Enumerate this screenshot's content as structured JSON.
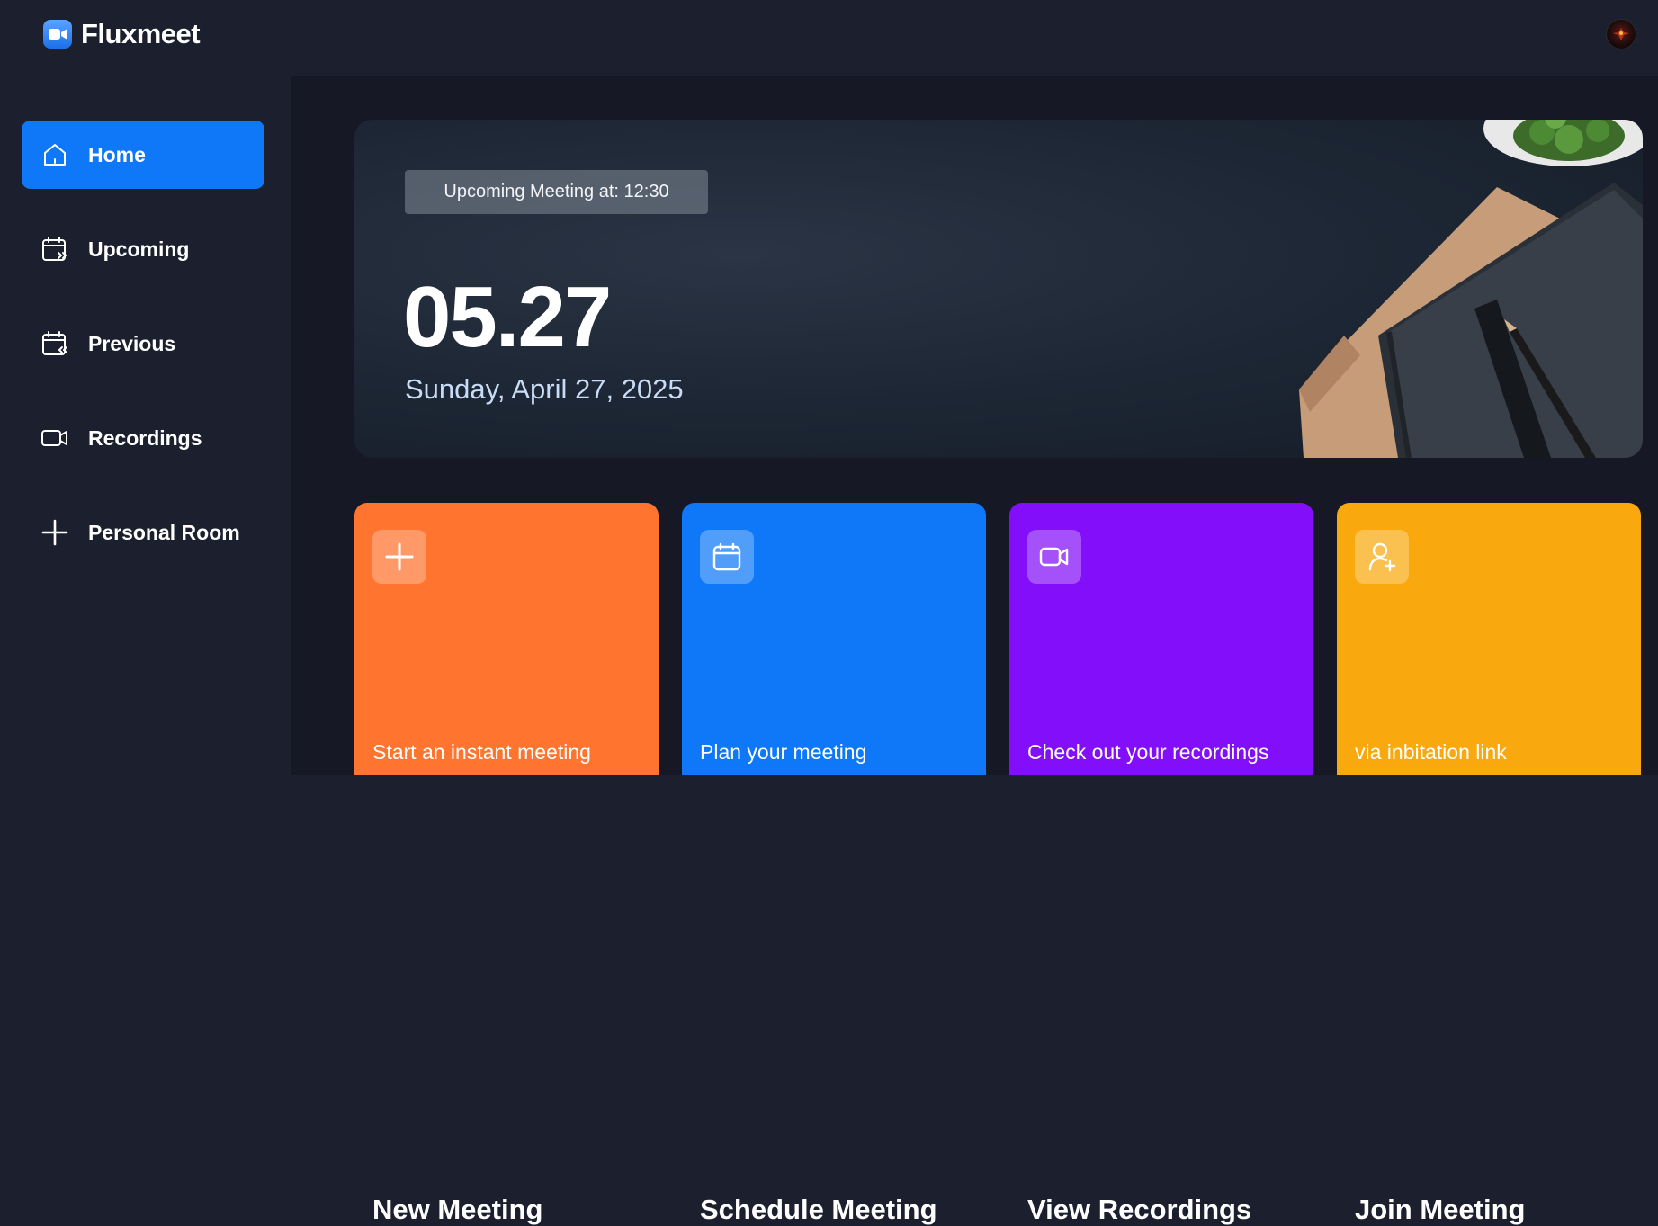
{
  "app": {
    "name": "Fluxmeet"
  },
  "sidebar": {
    "items": [
      {
        "label": "Home",
        "icon": "home-icon",
        "active": true
      },
      {
        "label": "Upcoming",
        "icon": "calendar-forward-icon",
        "active": false
      },
      {
        "label": "Previous",
        "icon": "calendar-back-icon",
        "active": false
      },
      {
        "label": "Recordings",
        "icon": "video-icon",
        "active": false
      },
      {
        "label": "Personal Room",
        "icon": "plus-icon",
        "active": false
      }
    ]
  },
  "hero": {
    "badge": "Upcoming Meeting at: 12:30",
    "time": "05.27",
    "date": "Sunday, April 27, 2025"
  },
  "cards": [
    {
      "title": "New Meeting",
      "subtitle": "Start an instant meeting",
      "icon": "plus-icon",
      "color": "#ff742e"
    },
    {
      "title": "Schedule Meeting",
      "subtitle": "Plan your meeting",
      "icon": "calendar-icon",
      "color": "#0e78f9"
    },
    {
      "title": "View Recordings",
      "subtitle": "Check out your recordings",
      "icon": "video-icon",
      "color": "#830ef9"
    },
    {
      "title": "Join Meeting",
      "subtitle": "via inbitation link",
      "icon": "user-add-icon",
      "color": "#f9a90e"
    }
  ],
  "colors": {
    "accent": "#0e78f9",
    "background": "#1c1f2e",
    "main_background": "#161925"
  }
}
